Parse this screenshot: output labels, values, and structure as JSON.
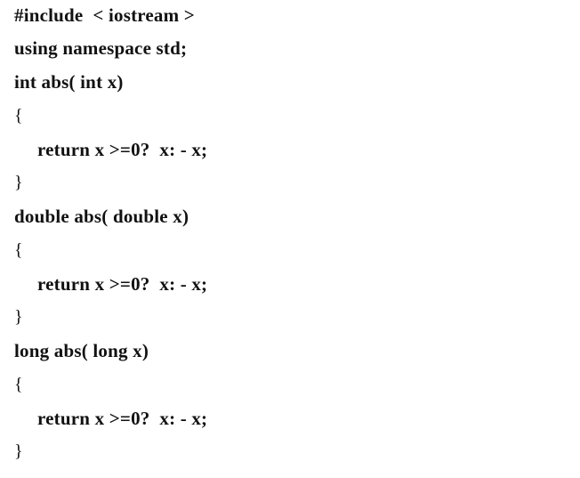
{
  "code": {
    "lines": [
      "#include  < iostream >",
      "using namespace std;",
      "int abs( int x)",
      "{",
      "return x >=0?  x: - x;",
      "}",
      "double abs( double x)",
      "{",
      "return x >=0?  x: - x;",
      "}",
      "long abs( long x)",
      "{",
      "return x >=0?  x: - x;",
      "}"
    ]
  }
}
